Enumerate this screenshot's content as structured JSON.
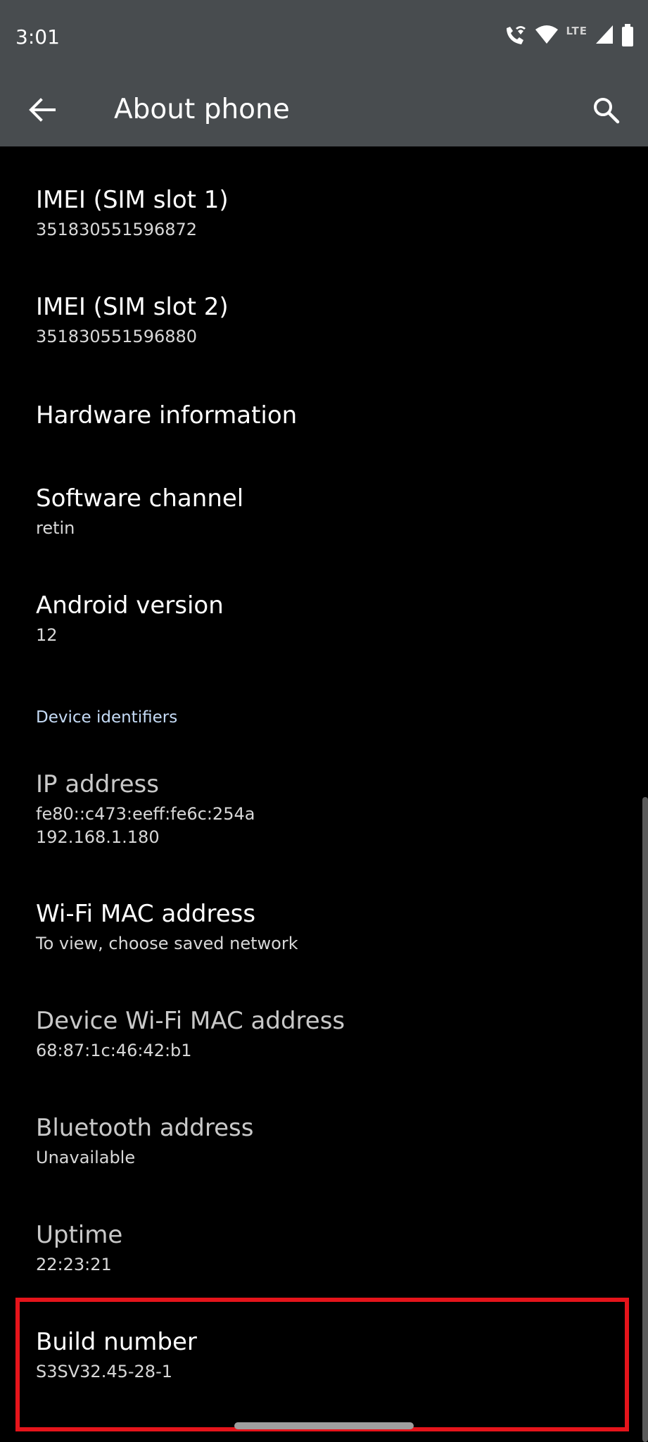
{
  "status_bar": {
    "time": "3:01",
    "network_label": "LTE",
    "icons": [
      "wifi-calling-icon",
      "wifi-icon",
      "cell-signal-icon",
      "battery-icon"
    ]
  },
  "app_bar": {
    "title": "About phone",
    "back_icon": "arrow-left-icon",
    "search_icon": "search-icon"
  },
  "items": [
    {
      "title": "IMEI (SIM slot 1)",
      "summary": "351830551596872"
    },
    {
      "title": "IMEI (SIM slot 2)",
      "summary": "351830551596880"
    },
    {
      "title": "Hardware information"
    },
    {
      "title": "Software channel",
      "summary": "retin"
    },
    {
      "title": "Android version",
      "summary": "12"
    }
  ],
  "section_header": "Device identifiers",
  "identifiers": [
    {
      "title": "IP address",
      "summary_lines": [
        "fe80::c473:eeff:fe6c:254a",
        "192.168.1.180"
      ]
    },
    {
      "title": "Wi-Fi MAC address",
      "summary": "To view, choose saved network"
    },
    {
      "title": "Device Wi-Fi MAC address",
      "summary": "68:87:1c:46:42:b1"
    },
    {
      "title": "Bluetooth address",
      "summary": "Unavailable"
    },
    {
      "title": "Uptime",
      "summary": "22:23:21"
    },
    {
      "title": "Build number",
      "summary": "S3SV32.45-28-1"
    }
  ],
  "colors": {
    "toolbar": "#484c4f",
    "background": "#000000",
    "section_header": "#c6dcf7",
    "highlight": "#e5141b"
  }
}
